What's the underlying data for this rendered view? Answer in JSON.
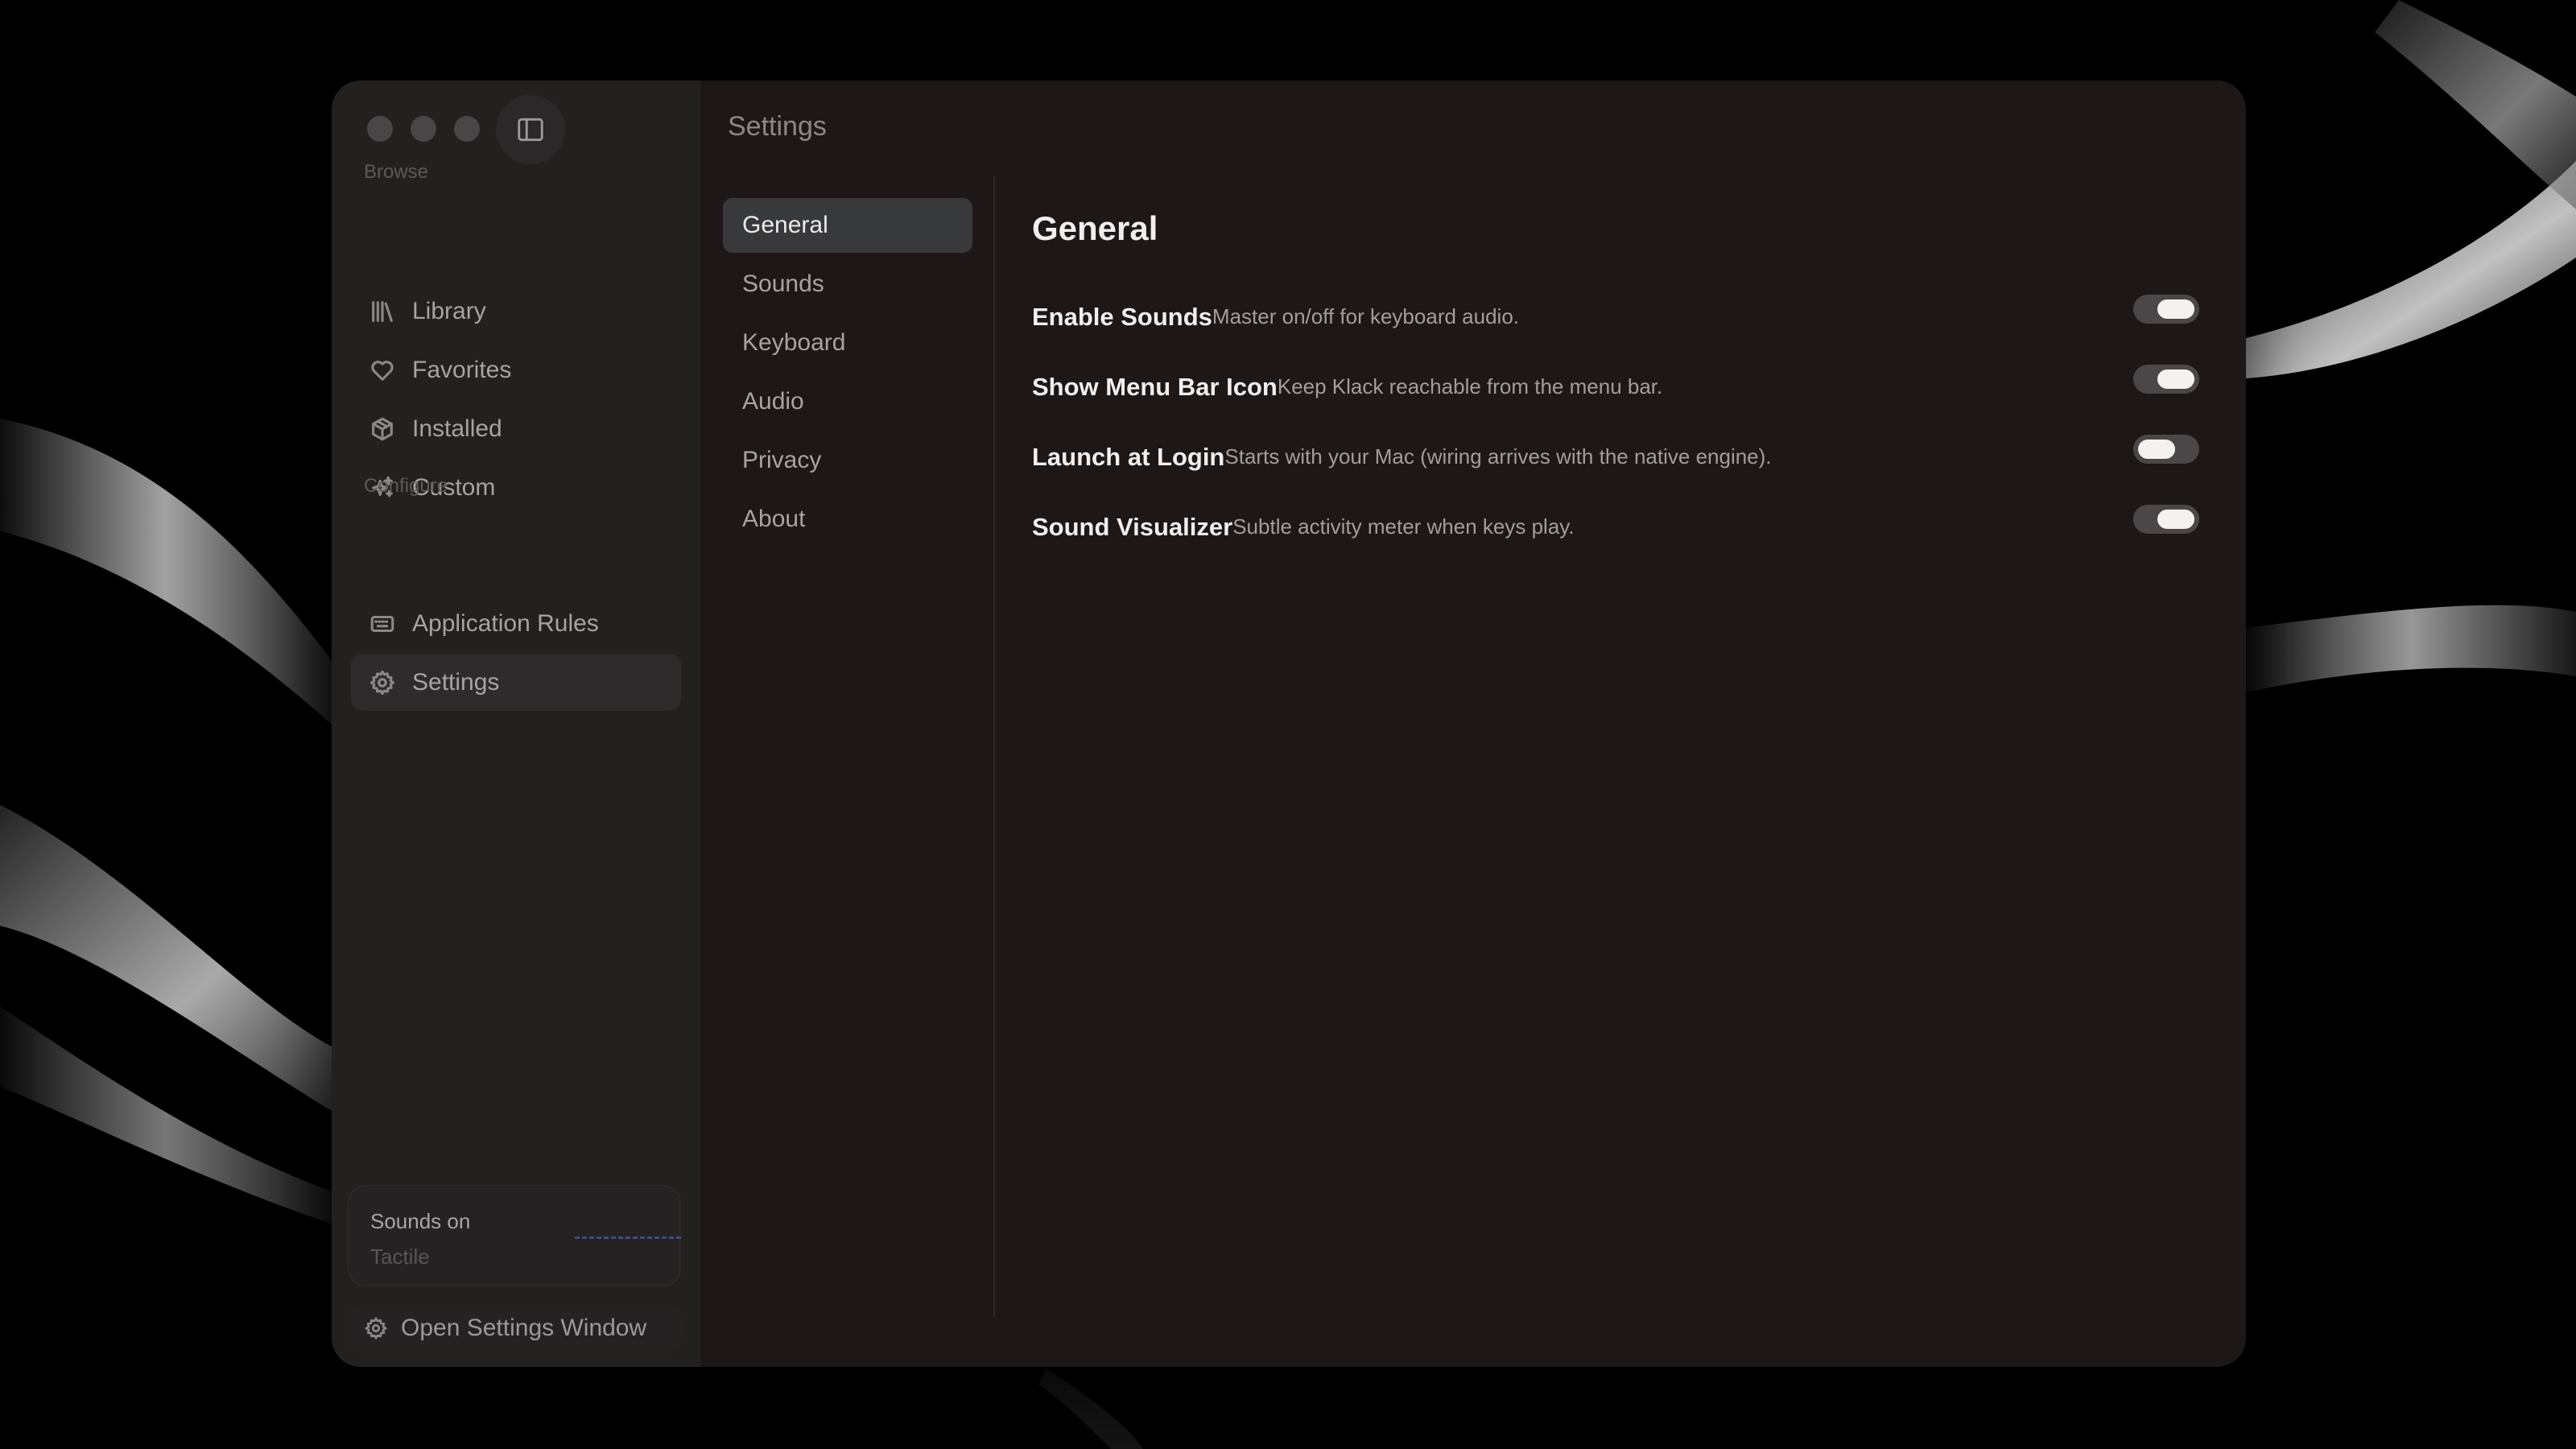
{
  "window": {
    "title": "Settings"
  },
  "sidebar": {
    "browse_label": "Browse",
    "configure_label": "Configure",
    "browse_items": [
      {
        "label": "Library",
        "icon": "library-icon"
      },
      {
        "label": "Favorites",
        "icon": "heart-icon"
      },
      {
        "label": "Installed",
        "icon": "package-icon"
      },
      {
        "label": "Custom",
        "icon": "sparkles-icon"
      }
    ],
    "configure_items": [
      {
        "label": "Application Rules",
        "icon": "keyboard-icon"
      },
      {
        "label": "Settings",
        "icon": "gear-icon",
        "active": true
      }
    ],
    "status_card": {
      "status": "Sounds on",
      "pack": "Tactile"
    },
    "open_settings_label": "Open Settings Window"
  },
  "settings_nav": {
    "items": [
      "General",
      "Sounds",
      "Keyboard",
      "Audio",
      "Privacy",
      "About"
    ],
    "selected": "General"
  },
  "general": {
    "heading": "General",
    "rows": [
      {
        "title": "Enable Sounds",
        "desc": "Master on/off for keyboard audio.",
        "on": true
      },
      {
        "title": "Show Menu Bar Icon",
        "desc": "Keep Klack reachable from the menu bar.",
        "on": true
      },
      {
        "title": "Launch at Login",
        "desc": "Starts with your Mac (wiring arrives with the native engine).",
        "on": false
      },
      {
        "title": "Sound Visualizer",
        "desc": "Subtle activity meter when keys play.",
        "on": true
      }
    ]
  },
  "colors": {
    "window_bg": "#1d1718",
    "sidebar_bg": "#232020",
    "accent_meter": "#3b4f82"
  }
}
